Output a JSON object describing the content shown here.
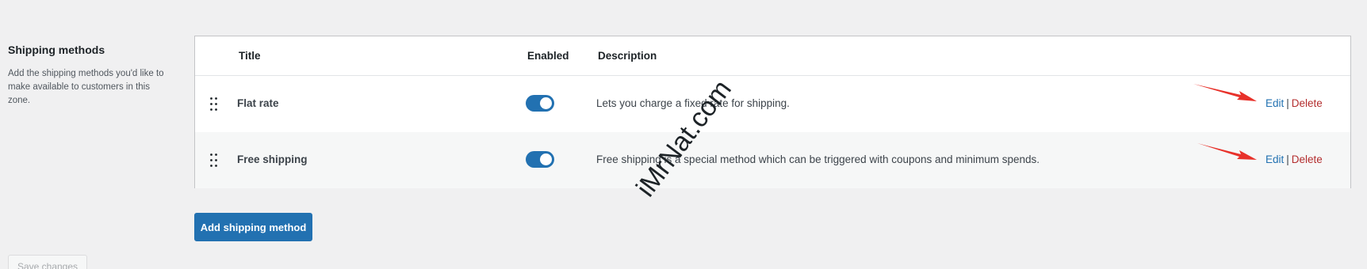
{
  "section": {
    "title": "Shipping methods",
    "description": "Add the shipping methods you'd like to make available to customers in this zone."
  },
  "table": {
    "headers": {
      "title": "Title",
      "enabled": "Enabled",
      "description": "Description"
    },
    "rows": [
      {
        "title": "Flat rate",
        "enabled": true,
        "description": "Lets you charge a fixed rate for shipping.",
        "edit_label": "Edit",
        "separator": "|",
        "delete_label": "Delete"
      },
      {
        "title": "Free shipping",
        "enabled": true,
        "description": "Free shipping is a special method which can be triggered with coupons and minimum spends.",
        "edit_label": "Edit",
        "separator": "|",
        "delete_label": "Delete"
      }
    ]
  },
  "buttons": {
    "add_method": "Add shipping method",
    "save_changes": "Save changes"
  },
  "watermark": "iMrNat.com",
  "colors": {
    "accent": "#2271b1",
    "delete": "#b32d2e",
    "annotation_arrow": "#e8312a",
    "background": "#f0f0f1"
  }
}
